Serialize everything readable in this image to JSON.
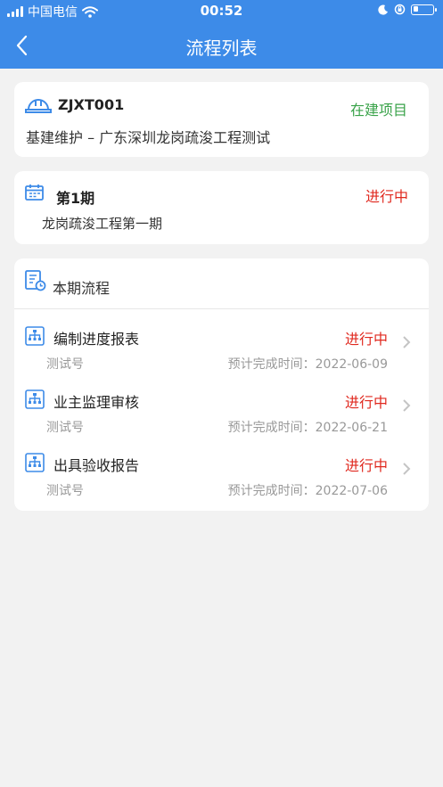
{
  "status_bar": {
    "carrier": "中国电信",
    "time": "00:52"
  },
  "header": {
    "title": "流程列表"
  },
  "project": {
    "code": "ZJXT001",
    "status": "在建项目",
    "description": "基建维护 – 广东深圳龙岗疏浚工程测试"
  },
  "phase": {
    "title": "第1期",
    "status": "进行中",
    "description": "龙岗疏浚工程第一期"
  },
  "flow_section": {
    "title": "本期流程",
    "items": [
      {
        "name": "编制进度报表",
        "status": "进行中",
        "sub": "测试号",
        "due": "预计完成时间：2022-06-09"
      },
      {
        "name": "业主监理审核",
        "status": "进行中",
        "sub": "测试号",
        "due": "预计完成时间：2022-06-21"
      },
      {
        "name": "出具验收报告",
        "status": "进行中",
        "sub": "测试号",
        "due": "预计完成时间：2022-07-06"
      }
    ]
  },
  "colors": {
    "primary": "#3d8be8",
    "in_construction": "#3aa34a",
    "in_progress": "#e0291f"
  },
  "icons": [
    "signal-icon",
    "wifi-icon",
    "moon-icon",
    "rotation-lock-icon",
    "battery-icon",
    "back-icon",
    "helmet-icon",
    "calendar-icon",
    "flow-list-icon",
    "org-chart-icon",
    "chevron-right-icon"
  ]
}
